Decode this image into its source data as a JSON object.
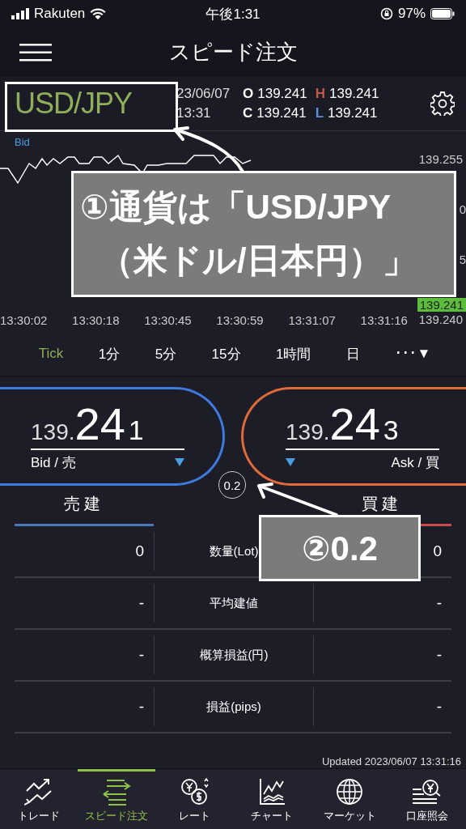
{
  "status_bar": {
    "carrier": "Rakuten",
    "time": "午後1:31",
    "battery": "97%"
  },
  "header": {
    "title": "スピード注文"
  },
  "quote": {
    "symbol": "USD/JPY",
    "date": "23/06/07",
    "time": "13:31",
    "ohlc": [
      {
        "label": "O",
        "value": "139.241",
        "kind": "open"
      },
      {
        "label": "H",
        "value": "139.241",
        "kind": "high"
      },
      {
        "label": "C",
        "value": "139.241",
        "kind": "close"
      },
      {
        "label": "L",
        "value": "139.241",
        "kind": "low"
      }
    ]
  },
  "chart": {
    "series_label": "Bid",
    "axis_labels": [
      "139.255",
      "0",
      "5"
    ],
    "current_price": "139.241",
    "low_label": "139.240",
    "times": [
      "13:30:02",
      "13:30:18",
      "13:30:45",
      "13:30:59",
      "13:31:07",
      "13:31:16"
    ]
  },
  "timeframes": [
    {
      "label": "Tick",
      "selected": true
    },
    {
      "label": "1分",
      "selected": false
    },
    {
      "label": "5分",
      "selected": false
    },
    {
      "label": "15分",
      "selected": false
    },
    {
      "label": "1時間",
      "selected": false
    },
    {
      "label": "日",
      "selected": false
    },
    {
      "label": "･･･▼",
      "selected": false
    }
  ],
  "prices": [
    {
      "kind": "bid",
      "head": "139.",
      "big": "24",
      "tail": "1",
      "label": "Bid / 売"
    },
    {
      "kind": "ask",
      "head": "139.",
      "big": "24",
      "tail": "3",
      "label": "Ask / 買"
    }
  ],
  "spread": "0.2",
  "positions": {
    "sell_header": "売建",
    "buy_header": "買建",
    "rows": [
      {
        "sell": "0",
        "label": "数量(Lot)",
        "buy": "0"
      },
      {
        "sell": "-",
        "label": "平均建値",
        "buy": "-"
      },
      {
        "sell": "-",
        "label": "概算損益(円)",
        "buy": "-"
      },
      {
        "sell": "-",
        "label": "損益(pips)",
        "buy": "-"
      }
    ]
  },
  "updated": "Updated  2023/06/07 13:31:16",
  "tab_bar": [
    {
      "label": "トレード",
      "selected": false
    },
    {
      "label": "スピード注文",
      "selected": true
    },
    {
      "label": "レート",
      "selected": false
    },
    {
      "label": "チャート",
      "selected": false
    },
    {
      "label": "マーケット",
      "selected": false
    },
    {
      "label": "口座照会",
      "selected": false
    }
  ],
  "annotations": [
    {
      "kind": "callout",
      "lines": [
        "①通貨は「USD/JPY",
        "（米ドル/日本円）」"
      ]
    },
    {
      "kind": "callout",
      "lines": [
        "②0.2"
      ]
    }
  ]
}
